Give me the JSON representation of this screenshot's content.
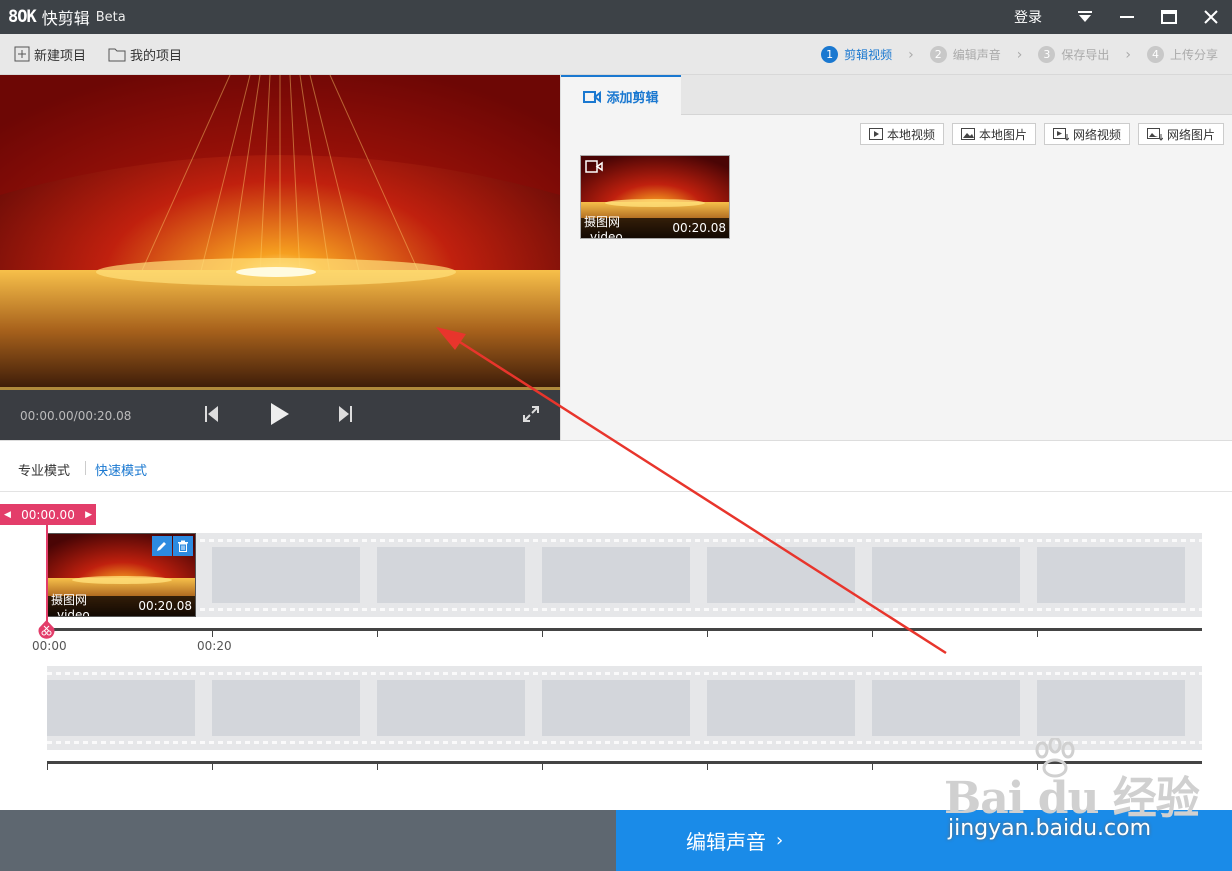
{
  "window": {
    "logo": "8OK",
    "app_name": "快剪辑",
    "app_badge": "Beta",
    "login_label": "登录"
  },
  "toolbar": {
    "new_project": "新建项目",
    "my_projects": "我的项目"
  },
  "steps": [
    {
      "num": "1",
      "label": "剪辑视频",
      "active": true
    },
    {
      "num": "2",
      "label": "编辑声音",
      "active": false
    },
    {
      "num": "3",
      "label": "保存导出",
      "active": false
    },
    {
      "num": "4",
      "label": "上传分享",
      "active": false
    }
  ],
  "player": {
    "timecode": "00:00.00/00:20.08"
  },
  "panel": {
    "tab_label": "添加剪辑",
    "source_buttons": [
      "本地视频",
      "本地图片",
      "网络视频",
      "网络图片"
    ],
    "media": {
      "name": "摄图网_video_...",
      "duration": "00:20.08"
    }
  },
  "modes": {
    "pro": "专业模式",
    "quick": "快速模式",
    "active": "quick"
  },
  "timeline": {
    "playhead_time": "00:00.00",
    "clip": {
      "name": "摄图网_video_...",
      "duration": "00:20.08"
    },
    "ruler_labels": [
      "00:00",
      "00:20"
    ]
  },
  "footer": {
    "next_label": "编辑声音"
  },
  "watermark": {
    "brand": "Bai du 经验",
    "url": "jingyan.baidu.com"
  },
  "colors": {
    "accent": "#1a78d0",
    "playhead": "#e33d6a",
    "next_button": "#1a8be8",
    "annotation_arrow": "#e8352c"
  }
}
